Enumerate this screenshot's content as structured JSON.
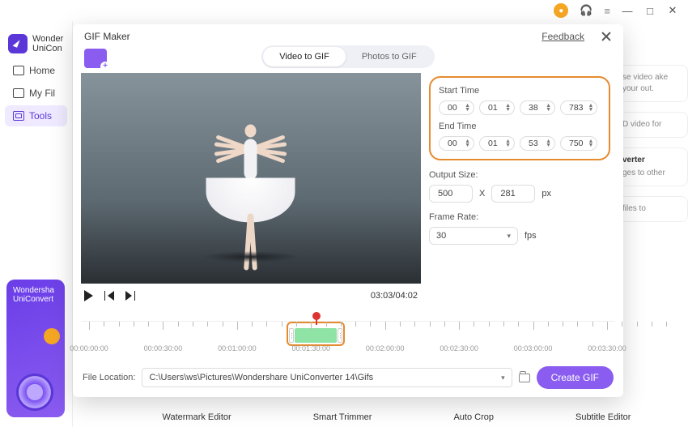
{
  "window": {
    "app_name": "Wondershare UniConverter"
  },
  "sidebar": {
    "app_label_1": "Wonder",
    "app_label_2": "UniCon",
    "items": [
      {
        "label": "Home"
      },
      {
        "label": "My Fil"
      },
      {
        "label": "Tools"
      }
    ]
  },
  "promo": {
    "line1": "Wondersha",
    "line2": "UniConvert"
  },
  "bg_cards": [
    {
      "title": "",
      "text": "se video ake your out."
    },
    {
      "title": "",
      "text": "D video for"
    },
    {
      "title": "verter",
      "text": "ges to other"
    },
    {
      "title": "",
      "text": "files to"
    }
  ],
  "bottom_tools": [
    "Watermark Editor",
    "Smart Trimmer",
    "Auto Crop",
    "Subtitle Editor"
  ],
  "modal": {
    "title": "GIF Maker",
    "feedback": "Feedback",
    "tabs": {
      "video": "Video to GIF",
      "photos": "Photos to GIF"
    },
    "time_display": "03:03/04:02",
    "start_label": "Start Time",
    "end_label": "End Time",
    "start": {
      "hh": "00",
      "mm": "01",
      "ss": "38",
      "ms": "783"
    },
    "end": {
      "hh": "00",
      "mm": "01",
      "ss": "53",
      "ms": "750"
    },
    "output_label": "Output Size:",
    "output": {
      "w": "500",
      "h": "281",
      "unit": "px",
      "sep": "X"
    },
    "framerate_label": "Frame Rate:",
    "framerate": {
      "value": "30",
      "unit": "fps"
    },
    "timeline_labels": [
      "00:00:00:00",
      "00:00:30:00",
      "00:01:00:00",
      "00:01:30:00",
      "00:02:00:00",
      "00:02:30:00",
      "00:03:00:00",
      "00:03:30:00"
    ],
    "file_location_label": "File Location:",
    "file_location": "C:\\Users\\ws\\Pictures\\Wondershare UniConverter 14\\Gifs",
    "create_label": "Create GIF"
  }
}
